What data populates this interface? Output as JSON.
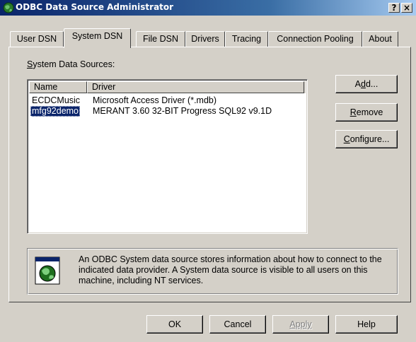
{
  "window": {
    "title": "ODBC Data Source Administrator",
    "help_btn": "?",
    "close_btn": "×"
  },
  "tabs": [
    {
      "label": "User DSN",
      "active": false
    },
    {
      "label": "System DSN",
      "active": true
    },
    {
      "label": "File DSN",
      "active": false
    },
    {
      "label": "Drivers",
      "active": false
    },
    {
      "label": "Tracing",
      "active": false
    },
    {
      "label": "Connection Pooling",
      "active": false
    },
    {
      "label": "About",
      "active": false
    }
  ],
  "panel": {
    "sources_label_u": "S",
    "sources_label_rest": "ystem Data Sources:",
    "columns": [
      "Name",
      "Driver"
    ],
    "rows": [
      {
        "name": "ECDCMusic",
        "driver": "Microsoft Access Driver (*.mdb)",
        "selected": false
      },
      {
        "name": "mfg92demo",
        "driver": "MERANT 3.60 32-BIT Progress SQL92 v9.1D",
        "selected": true
      }
    ],
    "add_a": "A",
    "add_u": "d",
    "add_rest": "d...",
    "remove_u": "R",
    "remove_rest": "emove",
    "configure_u": "C",
    "configure_rest": "onfigure...",
    "info_text": "An ODBC System data source stores information about how to connect to the indicated data provider.   A System data source is visible to all users on this machine, including NT services."
  },
  "footer": {
    "ok": "OK",
    "cancel": "Cancel",
    "apply": "Apply",
    "help": "Help"
  },
  "colors": {
    "titlebar_start": "#0a246a",
    "titlebar_end": "#a6caf0",
    "face": "#d4d0c8",
    "selection": "#0a246a"
  },
  "icons": {
    "title": "globe-database-icon",
    "info": "globe-document-icon"
  }
}
